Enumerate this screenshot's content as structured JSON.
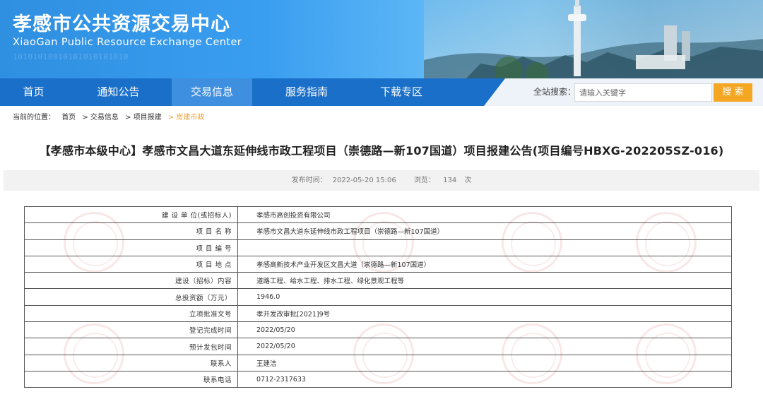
{
  "header": {
    "title_cn": "孝感市公共资源交易中心",
    "title_en": "XiaoGan Public Resource Exchange Center"
  },
  "nav": {
    "items": [
      {
        "label": "首页"
      },
      {
        "label": "通知公告"
      },
      {
        "label": "交易信息"
      },
      {
        "label": "服务指南"
      },
      {
        "label": "下载专区"
      }
    ],
    "active_index": 2,
    "search_label": "全站搜索：",
    "search_placeholder": "请输入关键字",
    "search_button": "搜 索"
  },
  "breadcrumb": {
    "prefix": "当前的位置：",
    "items": [
      "首页",
      "> 交易信息",
      "> 项目报建",
      "> 房建市政"
    ]
  },
  "article": {
    "title": "【孝感市本级中心】孝感市文昌大道东延伸线市政工程项目（崇德路—新107国道）项目报建公告(项目编号HBXG-202205SZ-016)",
    "publish_label": "发布时间：",
    "publish_time": "2022-05-20 15:06",
    "views_label": "浏览：",
    "views": "134",
    "views_unit": "次"
  },
  "table": {
    "rows": [
      {
        "key": "建 设 单 位(或招标人)",
        "value": "孝感市高创投资有限公司"
      },
      {
        "key": "项 目 名 称",
        "value": "孝感市文昌大道东延伸线市政工程项目（崇德路—新107国道）"
      },
      {
        "key": "项 目 编 号",
        "value": ""
      },
      {
        "key": "项 目 地 点",
        "value": "孝感高新技术产业开发区文昌大道（崇德路—新107国道）"
      },
      {
        "key": "建设（招标）内容",
        "value": "道路工程、给水工程、排水工程、绿化景观工程等"
      },
      {
        "key": "总投资额（万元）",
        "value": "1946.0"
      },
      {
        "key": "立项批准文号",
        "value": "孝开发改审批[2021]9号"
      },
      {
        "key": "登记完成时间",
        "value": "2022/05/20"
      },
      {
        "key": "预计发包时间",
        "value": "2022/05/20"
      },
      {
        "key": "联系人",
        "value": "王建洁"
      },
      {
        "key": "联系电话",
        "value": "0712-2317633"
      }
    ]
  }
}
